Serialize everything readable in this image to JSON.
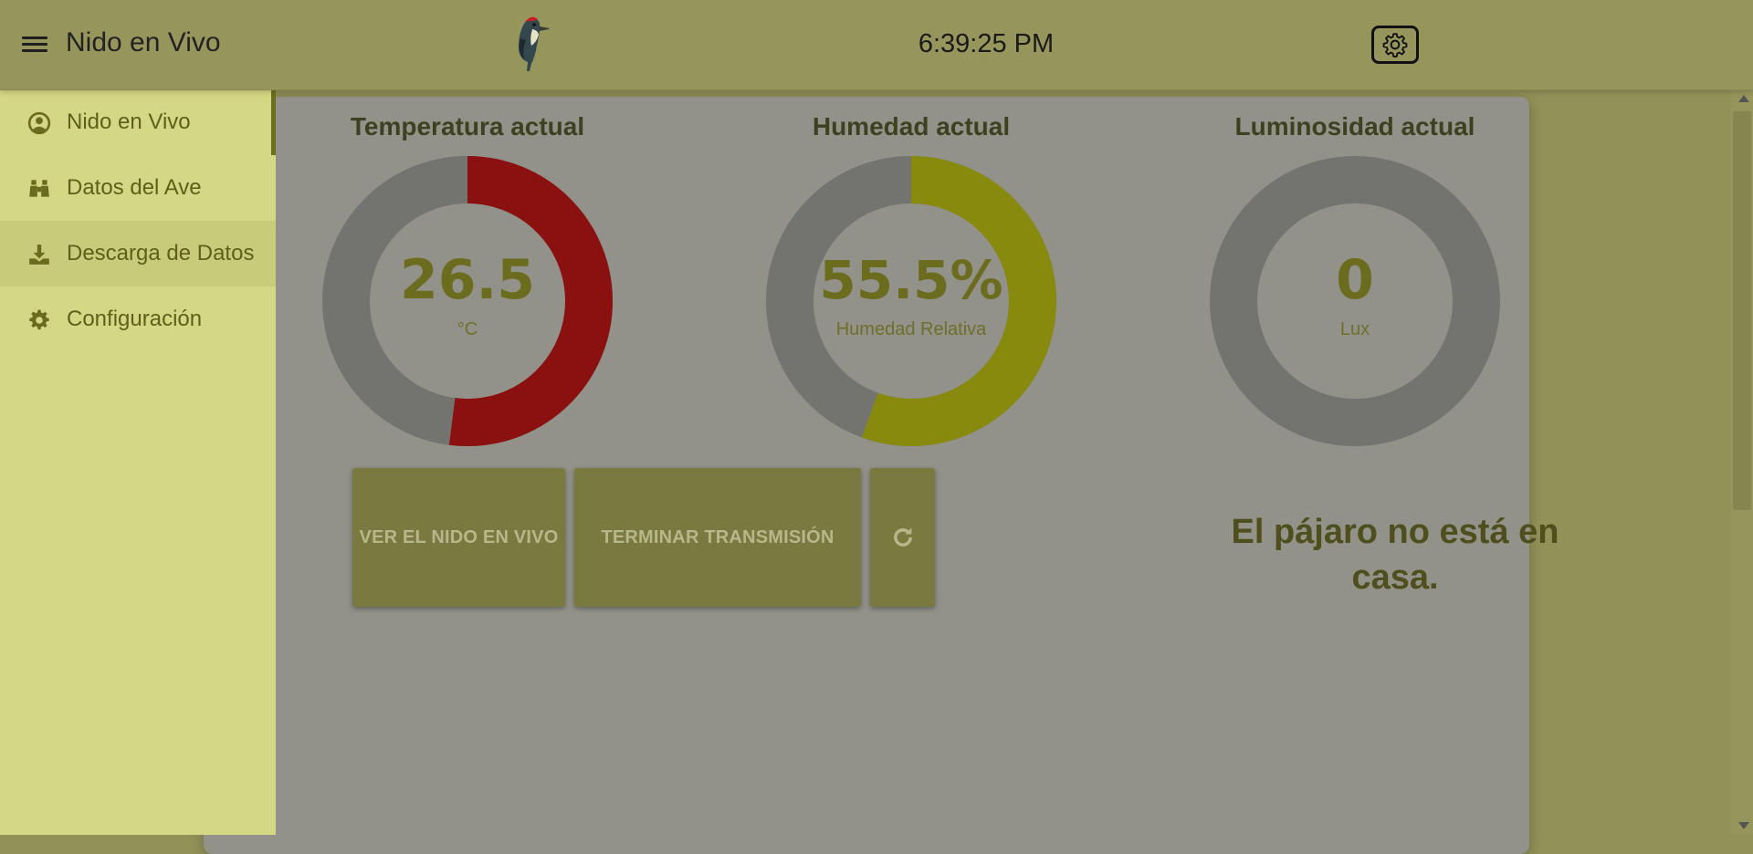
{
  "header": {
    "title": "Nido en Vivo",
    "clock": "6:39:25 PM",
    "menu_icon": "hamburger-menu-icon",
    "logo_icon": "woodpecker-logo",
    "settings_icon": "gear-icon"
  },
  "drawer": {
    "items": [
      {
        "label": "Nido en Vivo",
        "icon": "user-circle-icon",
        "active": true
      },
      {
        "label": "Datos del Ave",
        "icon": "binoculars-icon",
        "active": false
      },
      {
        "label": "Descarga de Datos",
        "icon": "download-icon",
        "active": false
      },
      {
        "label": "Configuración",
        "icon": "gear-icon",
        "active": false
      }
    ]
  },
  "gauges": {
    "temperature": {
      "title": "Temperatura actual",
      "value": "26.5",
      "unit": "°C",
      "fraction": 0.52,
      "color": "#8b1010"
    },
    "humidity": {
      "title": "Humedad actual",
      "value": "55.5%",
      "unit": "Humedad Relativa",
      "fraction": 0.555,
      "color": "#888a0e"
    },
    "light": {
      "title": "Luminosidad actual",
      "value": "0",
      "unit": "Lux",
      "fraction": 0,
      "color": "#7b7b2a"
    },
    "track_color": "#737370"
  },
  "buttons": {
    "watch_live": "VER EL NIDO EN VIVO",
    "stop_stream": "TERMINAR TRANSMISIÓN",
    "refresh_icon": "refresh-icon"
  },
  "status": {
    "message": "El pájaro no está en casa."
  }
}
